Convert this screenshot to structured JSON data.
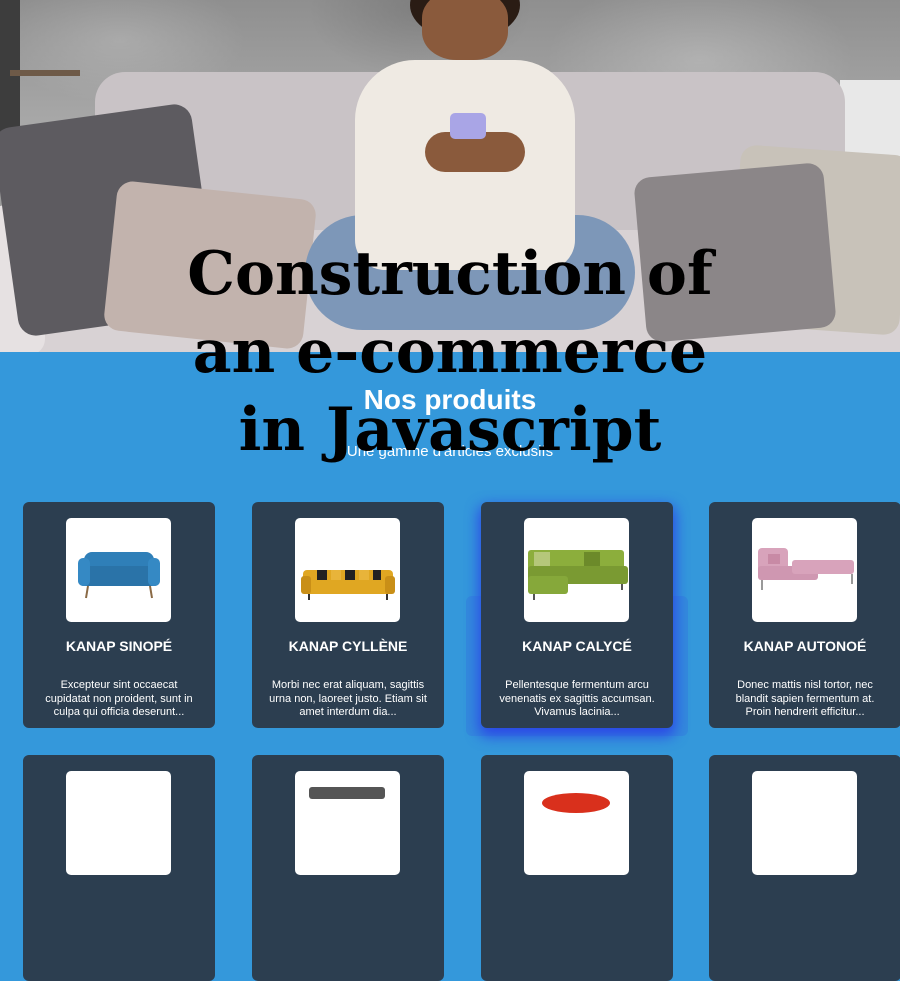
{
  "hero": {
    "image_alt": "Woman sitting on a sofa using a smartphone"
  },
  "overlay": {
    "lines": [
      "Construction of",
      "an e-commerce",
      "in Javascript"
    ]
  },
  "section": {
    "title": "Nos produits",
    "subtitle": "Une gamme d'articles exclusifs"
  },
  "products": [
    {
      "name": "KANAP SINOPÉ",
      "description": "Excepteur sint occaecat cupidatat non proident, sunt in culpa qui officia deserunt...",
      "image_icon": "blue-sofa-icon",
      "sofa_color": "#2f7fb8"
    },
    {
      "name": "KANAP CYLLÈNE",
      "description": "Morbi nec erat aliquam, sagittis urna non, laoreet justo. Etiam sit amet interdum dia...",
      "image_icon": "yellow-sofa-icon",
      "sofa_color": "#e0a722"
    },
    {
      "name": "KANAP CALYCÉ",
      "description": "Pellentesque fermentum arcu venenatis ex sagittis accumsan. Vivamus lacinia...",
      "image_icon": "green-sofa-icon",
      "sofa_color": "#8cae3c"
    },
    {
      "name": "KANAP AUTONOÉ",
      "description": "Donec mattis nisl tortor, nec blandit sapien fermentum at. Proin hendrerit efficitur...",
      "image_icon": "pink-sofa-icon",
      "sofa_color": "#d8a3bb"
    }
  ],
  "products_row2": [
    {
      "image_icon": "product-icon",
      "sofa_color": "#ffffff"
    },
    {
      "image_icon": "grey-sofa-icon",
      "sofa_color": "#555555"
    },
    {
      "image_icon": "red-sofa-icon",
      "sofa_color": "#d9301c"
    },
    {
      "image_icon": "product-icon",
      "sofa_color": "#ffffff"
    }
  ],
  "colors": {
    "section_bg": "#3498db",
    "card_bg": "#2c3e50",
    "highlight_shadow": "#2b46e6"
  }
}
